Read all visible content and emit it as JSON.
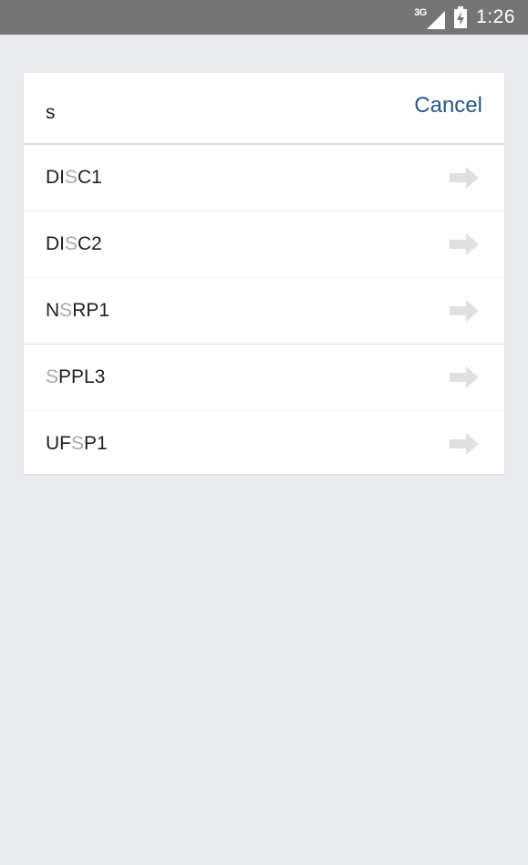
{
  "status_bar": {
    "network_type": "3G",
    "time": "1:26",
    "signal_icon": "signal-icon",
    "battery_icon": "battery-charging-icon"
  },
  "search": {
    "query": "s",
    "cancel_label": "Cancel"
  },
  "results": [
    {
      "label": "DISC1",
      "match_start": 2,
      "arrow_icon": "arrow-right-icon"
    },
    {
      "label": "DISC2",
      "match_start": 2,
      "arrow_icon": "arrow-right-icon"
    },
    {
      "label": "NSRP1",
      "match_start": 1,
      "arrow_icon": "arrow-right-icon"
    },
    {
      "label": "SPPL3",
      "match_start": 0,
      "arrow_icon": "arrow-right-icon"
    },
    {
      "label": "UFSP1",
      "match_start": 2,
      "arrow_icon": "arrow-right-icon"
    }
  ],
  "colors": {
    "background": "#e9eaee",
    "status_bar": "#757575",
    "accent": "#2a5886",
    "highlight": "#a8a8a8",
    "arrow": "#e0e0e0"
  }
}
